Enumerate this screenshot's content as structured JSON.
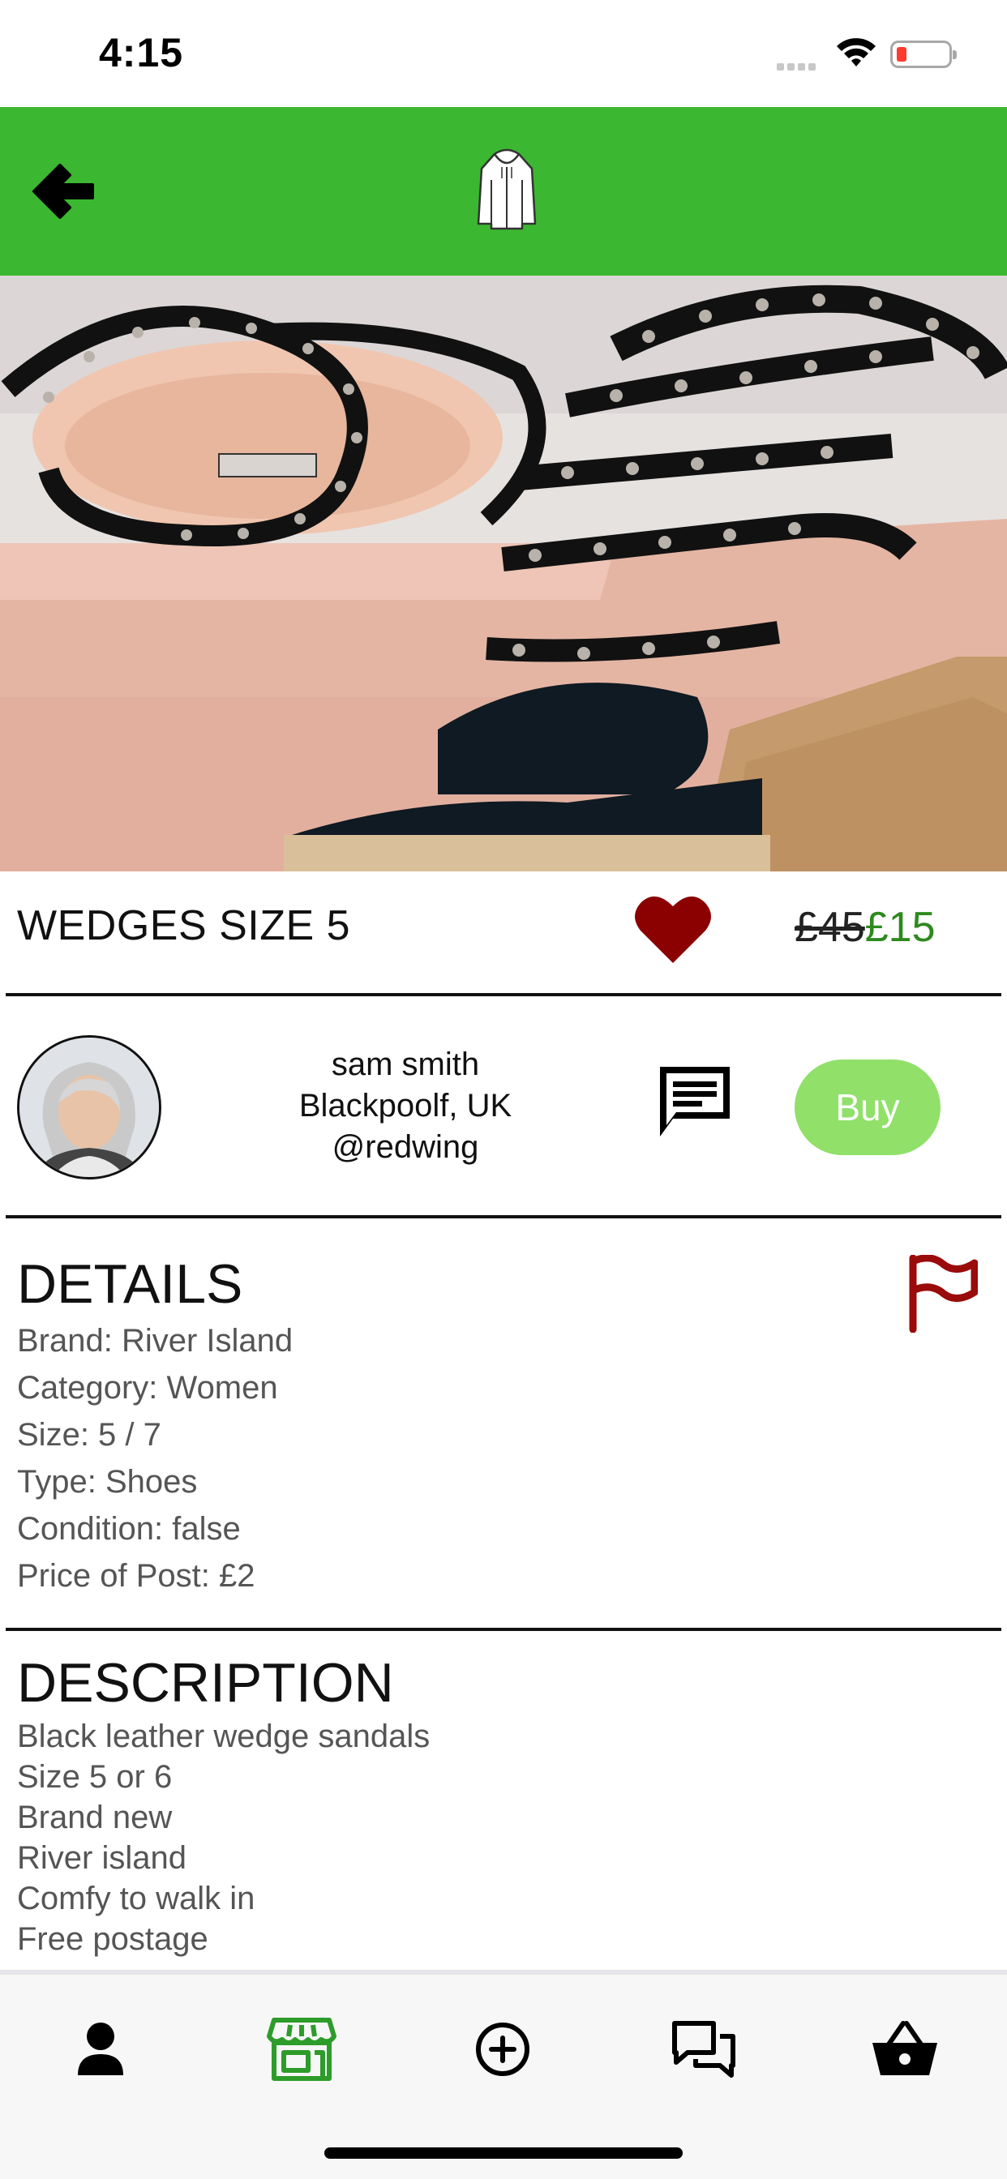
{
  "status_bar": {
    "time": "4:15"
  },
  "product": {
    "title": "WEDGES SIZE 5",
    "old_price": "£45",
    "new_price": "£15",
    "favorited": true
  },
  "seller": {
    "name": "sam smith",
    "location": "Blackpoolf, UK",
    "handle": "@redwing"
  },
  "actions": {
    "buy_label": "Buy"
  },
  "details": {
    "heading": "DETAILS",
    "items": [
      "Brand: River Island",
      "Category: Women",
      "Size: 5 / 7",
      "Type: Shoes",
      "Condition: false",
      "Price of Post: £2"
    ]
  },
  "description": {
    "heading": "DESCRIPTION",
    "lines": [
      "Black leather wedge sandals",
      "Size 5 or 6",
      "Brand new",
      "River island",
      "Comfy to walk in",
      "Free postage"
    ]
  },
  "tab_bar": {
    "tabs": [
      {
        "icon": "person-icon",
        "active": false
      },
      {
        "icon": "shop-icon",
        "active": true
      },
      {
        "icon": "add-circle-icon",
        "active": false
      },
      {
        "icon": "chat-icon",
        "active": false
      },
      {
        "icon": "basket-icon",
        "active": false
      }
    ]
  },
  "colors": {
    "header_green": "#3cb731",
    "buy_button": "#90e06a",
    "sale_price": "#2d8a1e",
    "favorite_heart": "#8b0000",
    "report_flag": "#9a0b0b",
    "active_tab": "#2d9c2a"
  }
}
